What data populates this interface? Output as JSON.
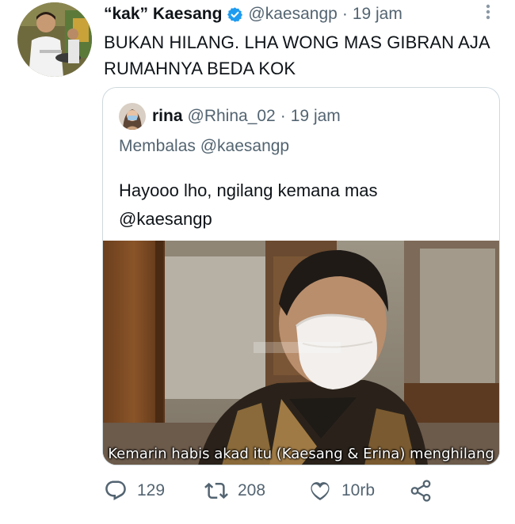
{
  "tweet": {
    "author_name": "“kak” Kaesang",
    "handle": "@kaesangp",
    "separator": "·",
    "time": "19 jam",
    "text": "BUKAN HILANG. LHA WONG MAS GIBRAN AJA RUMAHNYA BEDA KOK"
  },
  "quoted": {
    "author_name": "rina",
    "handle": "@Rhina_02",
    "separator": "·",
    "time": "19 jam",
    "reply_prefix": "Membalas",
    "reply_to": "@kaesangp",
    "text": "Hayooo lho, ngilang kemana mas @kaesangp",
    "media_caption": "Kemarin habis akad itu (Kaesang & Erina) menghilang",
    "watermark": "PROPERTY OF ..."
  },
  "actions": {
    "replies": "129",
    "retweets": "208",
    "likes": "10rb"
  },
  "icons": {
    "verified": "verified-badge-icon",
    "more": "more-dots-icon",
    "reply": "reply-icon",
    "retweet": "retweet-icon",
    "like": "heart-icon",
    "share": "share-icon"
  },
  "colors": {
    "verified": "#1d9bf0",
    "secondary_text": "#536471",
    "border": "#cfd9de"
  }
}
